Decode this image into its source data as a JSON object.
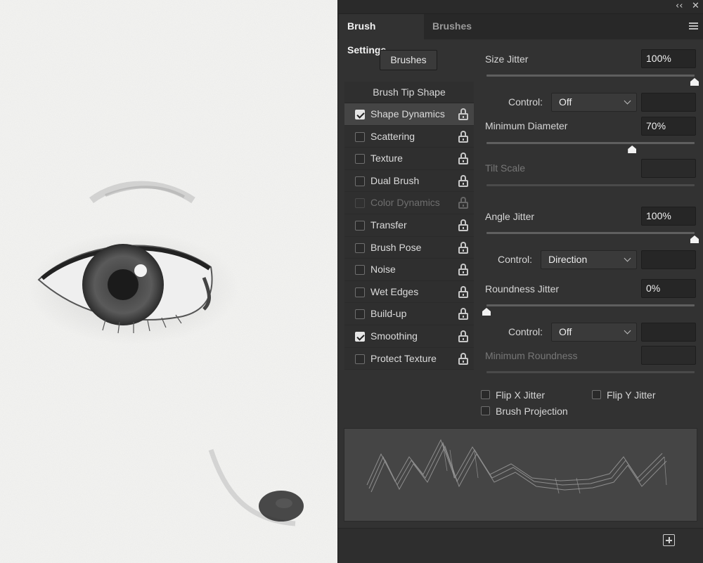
{
  "panel": {
    "collapse_glyph": "‹‹",
    "close_glyph": "✕",
    "tabs": [
      {
        "label": "Brush Settings",
        "active": true
      },
      {
        "label": "Brushes",
        "active": false
      }
    ],
    "brushes_button": "Brushes",
    "brush_tip_shape": "Brush Tip Shape",
    "sections": [
      {
        "label": "Shape Dynamics",
        "checked": true,
        "selected": true,
        "enabled": true
      },
      {
        "label": "Scattering",
        "checked": false,
        "selected": false,
        "enabled": true
      },
      {
        "label": "Texture",
        "checked": false,
        "selected": false,
        "enabled": true
      },
      {
        "label": "Dual Brush",
        "checked": false,
        "selected": false,
        "enabled": true
      },
      {
        "label": "Color Dynamics",
        "checked": false,
        "selected": false,
        "enabled": false
      },
      {
        "label": "Transfer",
        "checked": false,
        "selected": false,
        "enabled": true
      },
      {
        "label": "Brush Pose",
        "checked": false,
        "selected": false,
        "enabled": true
      },
      {
        "label": "Noise",
        "checked": false,
        "selected": false,
        "enabled": true
      },
      {
        "label": "Wet Edges",
        "checked": false,
        "selected": false,
        "enabled": true
      },
      {
        "label": "Build-up",
        "checked": false,
        "selected": false,
        "enabled": true
      },
      {
        "label": "Smoothing",
        "checked": true,
        "selected": false,
        "enabled": true
      },
      {
        "label": "Protect Texture",
        "checked": false,
        "selected": false,
        "enabled": true
      }
    ],
    "size_jitter": {
      "label": "Size Jitter",
      "value": "100%",
      "level": 1.0
    },
    "control_1": {
      "label": "Control:",
      "value": "Off"
    },
    "minimum_diameter": {
      "label": "Minimum Diameter",
      "value": "70%",
      "level": 0.7
    },
    "tilt_scale": {
      "label": "Tilt Scale",
      "value": ""
    },
    "angle_jitter": {
      "label": "Angle Jitter",
      "value": "100%",
      "level": 1.0
    },
    "control_2": {
      "label": "Control:",
      "value": "Direction"
    },
    "roundness_jitter": {
      "label": "Roundness Jitter",
      "value": "0%",
      "level": 0.0
    },
    "control_3": {
      "label": "Control:",
      "value": "Off"
    },
    "minimum_roundness": {
      "label": "Minimum Roundness",
      "value": ""
    },
    "flip_x": {
      "label": "Flip X Jitter",
      "checked": false
    },
    "flip_y": {
      "label": "Flip Y Jitter",
      "checked": false
    },
    "brush_projection": {
      "label": "Brush Projection",
      "checked": false
    },
    "colors": {
      "panel": "#323232",
      "field": "#262626",
      "preview": "#454545"
    }
  }
}
